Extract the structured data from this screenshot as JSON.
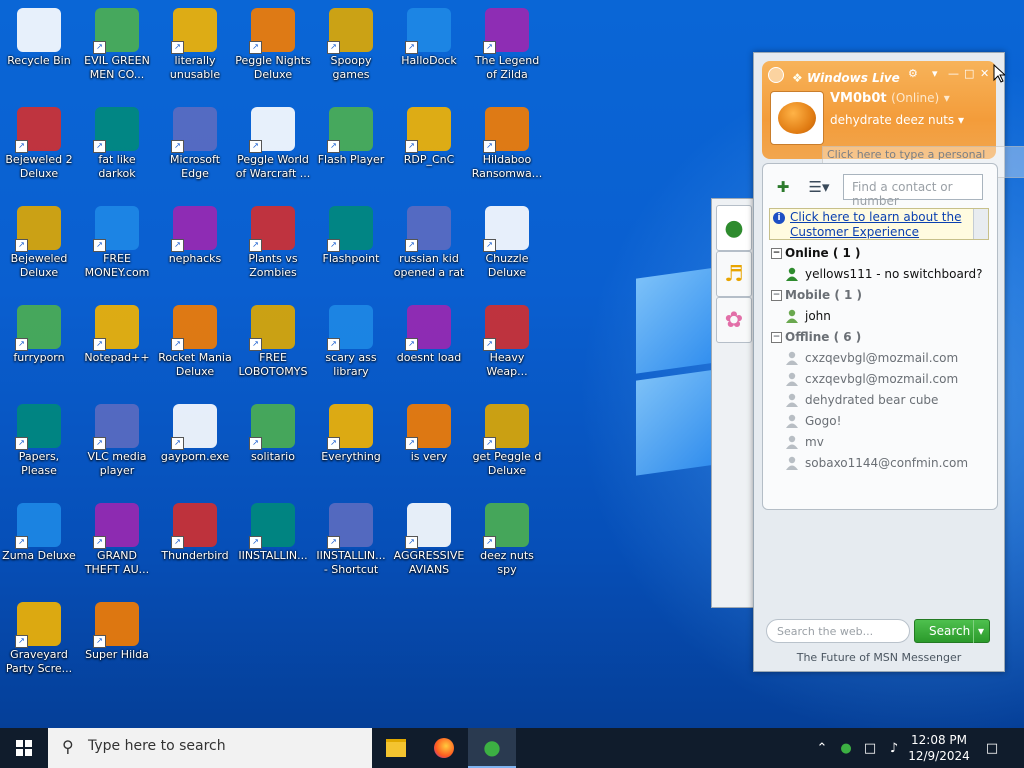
{
  "desktop_icons": [
    {
      "label": "Recycle Bin",
      "icon": "recycle-bin-icon"
    },
    {
      "label": "EVIL GREEN MEN CO...",
      "icon": "msn-men-icon"
    },
    {
      "label": "literally unusable",
      "icon": "chrome-icon"
    },
    {
      "label": "Peggle Nights Deluxe",
      "icon": "peggle-icon"
    },
    {
      "label": "Spoopy games",
      "icon": "folder-icon"
    },
    {
      "label": "HalloDock",
      "icon": "shield-icon"
    },
    {
      "label": "The Legend of Zilda",
      "icon": "zilda-icon"
    },
    {
      "label": "Bejeweled 2 Deluxe",
      "icon": "bejeweled2-icon"
    },
    {
      "label": "fat like darkok",
      "icon": "mpi-icon"
    },
    {
      "label": "Microsoft Edge",
      "icon": "edge-icon"
    },
    {
      "label": "Peggle World of Warcraft ...",
      "icon": "peggle-icon"
    },
    {
      "label": "Flash Player",
      "icon": "flash-icon"
    },
    {
      "label": "RDP_CnC",
      "icon": "rdp-icon"
    },
    {
      "label": "Hildaboo Ransomwa...",
      "icon": "yashma-icon"
    },
    {
      "label": "Bejeweled Deluxe",
      "icon": "diamond-icon"
    },
    {
      "label": "FREE MONEY.com",
      "icon": "money-bag-icon"
    },
    {
      "label": "nephacks",
      "icon": "mpi-icon"
    },
    {
      "label": "Plants vs Zombies",
      "icon": "pvz-icon"
    },
    {
      "label": "Flashpoint",
      "icon": "blank-file-icon"
    },
    {
      "label": "russian kid opened a rat",
      "icon": "de-icon"
    },
    {
      "label": "Chuzzle Deluxe",
      "icon": "chuzzle-icon"
    },
    {
      "label": "furryporn",
      "icon": "firefox-icon"
    },
    {
      "label": "Notepad++",
      "icon": "notepadpp-icon"
    },
    {
      "label": "Rocket Mania Deluxe",
      "icon": "rocket-icon"
    },
    {
      "label": "FREE LOBOTOMYS",
      "icon": "lobotomy-icon"
    },
    {
      "label": "scary ass library",
      "icon": "library-icon"
    },
    {
      "label": "doesnt load",
      "icon": "thunderbird-icon"
    },
    {
      "label": "Heavy Weap...",
      "icon": "radiation-icon"
    },
    {
      "label": "Papers, Please",
      "icon": "blank-file-icon"
    },
    {
      "label": "VLC media player",
      "icon": "vlc-icon"
    },
    {
      "label": "gayporn.exe",
      "icon": "flash-icon"
    },
    {
      "label": "solitario",
      "icon": "solitaire-icon"
    },
    {
      "label": "Everything",
      "icon": "search-icon"
    },
    {
      "label": "is very",
      "icon": "mpi-icon"
    },
    {
      "label": "get Peggle d Deluxe",
      "icon": "peggle-icon"
    },
    {
      "label": "Zuma Deluxe",
      "icon": "zuma-icon"
    },
    {
      "label": "GRAND THEFT AU...",
      "icon": "anime-icon"
    },
    {
      "label": "Thunderbird",
      "icon": "thunderbird-icon"
    },
    {
      "label": "IINSTALLIN...",
      "icon": "text-file-icon"
    },
    {
      "label": "IINSTALLIN... - Shortcut",
      "icon": "text-file-icon"
    },
    {
      "label": "AGGRESSIVE AVIANS",
      "icon": "angry-bird-icon"
    },
    {
      "label": "deez nuts spy",
      "icon": "cube-icon"
    },
    {
      "label": "Graveyard Party Scre...",
      "icon": "graveyard-icon"
    },
    {
      "label": "Super Hilda",
      "icon": "hilda-icon"
    }
  ],
  "msn": {
    "title": "Windows Live",
    "username": "VM0b0t",
    "status": "(Online)",
    "personal_message": "dehydrate deez nuts",
    "tooltip": "Click here to type a personal message for your contacts",
    "find_placeholder": "Find a contact or number",
    "info_link": "Click here to learn about the Customer Experience",
    "groups": [
      {
        "name": "Online ( 1 )",
        "contacts": [
          "yellows111 - no switchboard?"
        ]
      },
      {
        "name": "Mobile ( 1 )",
        "contacts": [
          "john"
        ]
      },
      {
        "name": "Offline ( 6 )",
        "contacts": [
          "cxzqevbgl@mozmail.com",
          "cxzqevbgl@mozmail.com",
          "dehydrated bear cube",
          "Gogo!",
          "mv",
          "sobaxo1144@confmin.com"
        ]
      }
    ],
    "web_search_placeholder": "Search the web...",
    "search_button": "Search",
    "footer": "The Future of MSN Messenger"
  },
  "taskbar": {
    "search_placeholder": "Type here to search",
    "time": "12:08 PM",
    "date": "12/9/2024"
  },
  "colors": {
    "desktop": "#0a5fd0",
    "msn_header": "#f39c3a",
    "taskbar": "#101c2c",
    "search_green": "#2b9a2b"
  }
}
